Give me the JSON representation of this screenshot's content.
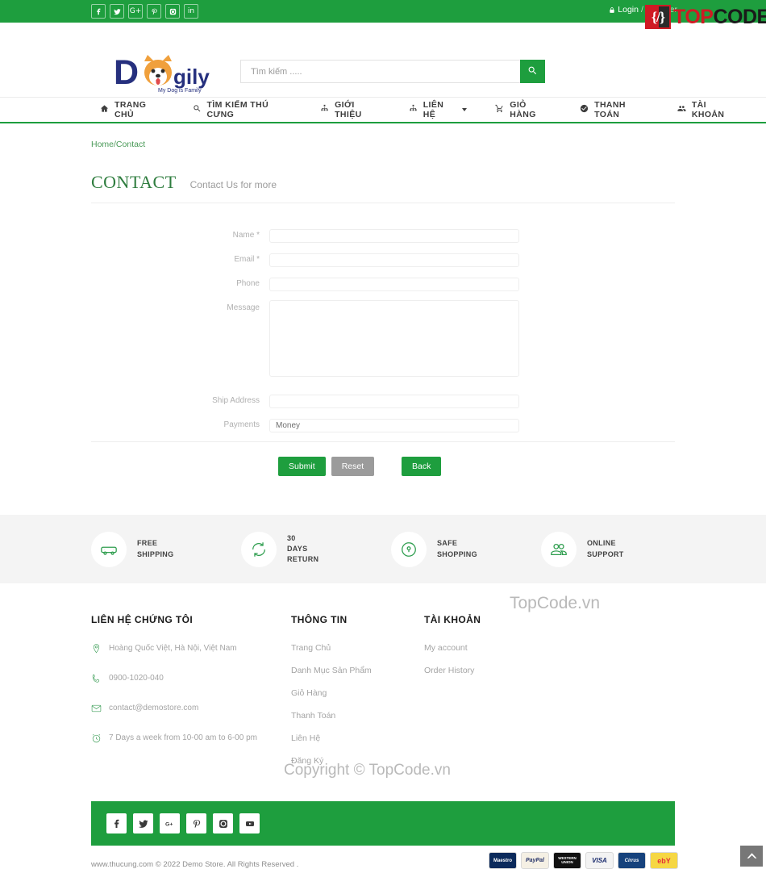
{
  "topbar": {
    "social": [
      {
        "name": "facebook-icon",
        "label": "f"
      },
      {
        "name": "twitter-icon",
        "label": "t"
      },
      {
        "name": "google-plus-icon",
        "label": "G+"
      },
      {
        "name": "pinterest-icon",
        "label": "P"
      },
      {
        "name": "instagram-icon",
        "label": "ig"
      },
      {
        "name": "linkedin-icon",
        "label": "in"
      }
    ],
    "login": "Login",
    "separator": "/",
    "register": "Register",
    "watermark_red": "TOP",
    "watermark_black": "CODE.VN",
    "watermark_mark": "{/}"
  },
  "header": {
    "logo_text": "Dogily",
    "logo_d": "D",
    "logo_gily": "gily",
    "logo_tagline": "My Dog is Family",
    "search_placeholder": "Tìm kiếm .....",
    "search_value": ""
  },
  "nav": {
    "items": [
      {
        "label": "TRANG CHỦ",
        "icon": "home-icon",
        "caret": false
      },
      {
        "label": "TÌM KIẾM THÚ CƯNG",
        "icon": "search-icon",
        "caret": false
      },
      {
        "label": "GIỚI THIỆU",
        "icon": "sitemap-icon",
        "caret": false
      },
      {
        "label": "LIÊN HỆ",
        "icon": "sitemap-icon",
        "caret": true
      },
      {
        "label": "GIỎ HÀNG",
        "icon": "cart-icon",
        "caret": false
      },
      {
        "label": "THANH TOÁN",
        "icon": "check-circle-icon",
        "caret": false
      },
      {
        "label": "TÀI KHOẢN",
        "icon": "users-icon",
        "caret": false
      }
    ]
  },
  "breadcrumb": "Home/Contact",
  "page": {
    "title": "CONTACT",
    "subtitle": "Contact Us for more"
  },
  "form": {
    "fields": [
      {
        "label": "Name *",
        "type": "text",
        "value": "",
        "name": "name-field"
      },
      {
        "label": "Email *",
        "type": "text",
        "value": "",
        "name": "email-field"
      },
      {
        "label": "Phone",
        "type": "text",
        "value": "",
        "name": "phone-field"
      },
      {
        "label": "Message",
        "type": "textarea",
        "value": "",
        "name": "message-field"
      },
      {
        "label": "Ship Address",
        "type": "text",
        "value": "",
        "name": "ship-address-field"
      },
      {
        "label": "Payments",
        "type": "text",
        "value": "Money",
        "name": "payments-field"
      }
    ],
    "submit": "Submit",
    "reset": "Reset",
    "back": "Back"
  },
  "features": [
    {
      "icon": "truck-icon",
      "line1": "FREE",
      "line2": "SHIPPING",
      "line3": ""
    },
    {
      "icon": "refresh-icon",
      "line1": "30",
      "line2": "DAYS",
      "line3": "RETURN"
    },
    {
      "icon": "lock-icon",
      "line1": "SAFE",
      "line2": "SHOPPING",
      "line3": ""
    },
    {
      "icon": "users-icon",
      "line1": "ONLINE",
      "line2": "SUPPORT",
      "line3": ""
    }
  ],
  "footer": {
    "col1_title": "LIÊN HỆ CHỨNG TÔI",
    "contact": [
      {
        "icon": "map-pin-icon",
        "text": "Hoàng Quốc Việt, Hà Nội, Việt Nam"
      },
      {
        "icon": "phone-icon",
        "text": "0900-1020-040"
      },
      {
        "icon": "envelope-icon",
        "text": "contact@demostore.com"
      },
      {
        "icon": "clock-icon",
        "text": "7 Days a week from 10-00 am to 6-00 pm"
      }
    ],
    "col2_title": "THÔNG TIN",
    "info_links": [
      "Trang Chủ",
      "Danh Mục Sản Phẩm",
      "Giỏ Hàng",
      "Thanh Toán",
      "Liên Hệ",
      "Đăng Ký"
    ],
    "col3_title": "TÀI KHOẢN",
    "account_links": [
      "My account",
      "Order History"
    ],
    "social": [
      {
        "name": "facebook-icon"
      },
      {
        "name": "twitter-icon"
      },
      {
        "name": "google-plus-icon"
      },
      {
        "name": "pinterest-icon"
      },
      {
        "name": "instagram-icon"
      },
      {
        "name": "youtube-icon"
      }
    ],
    "copyright": "www.thucung.com © 2022 Demo Store. All Rights Reserved .",
    "payments": [
      {
        "name": "maestro",
        "label": "Maestro"
      },
      {
        "name": "paypal",
        "label": "PayPal"
      },
      {
        "name": "western-union",
        "label": "WESTERN UNION"
      },
      {
        "name": "visa",
        "label": "VISA"
      },
      {
        "name": "cirrus",
        "label": "Cirrus"
      },
      {
        "name": "ebay",
        "label": "ebY"
      }
    ]
  },
  "watermarks": {
    "middle": "TopCode.vn",
    "copyright": "Copyright © TopCode.vn"
  },
  "colors": {
    "brand_green": "#1e9e3e",
    "title_green": "#2f7d3f",
    "gray_btn": "#9b9b9b",
    "feature_bg": "#f4f4f4"
  }
}
